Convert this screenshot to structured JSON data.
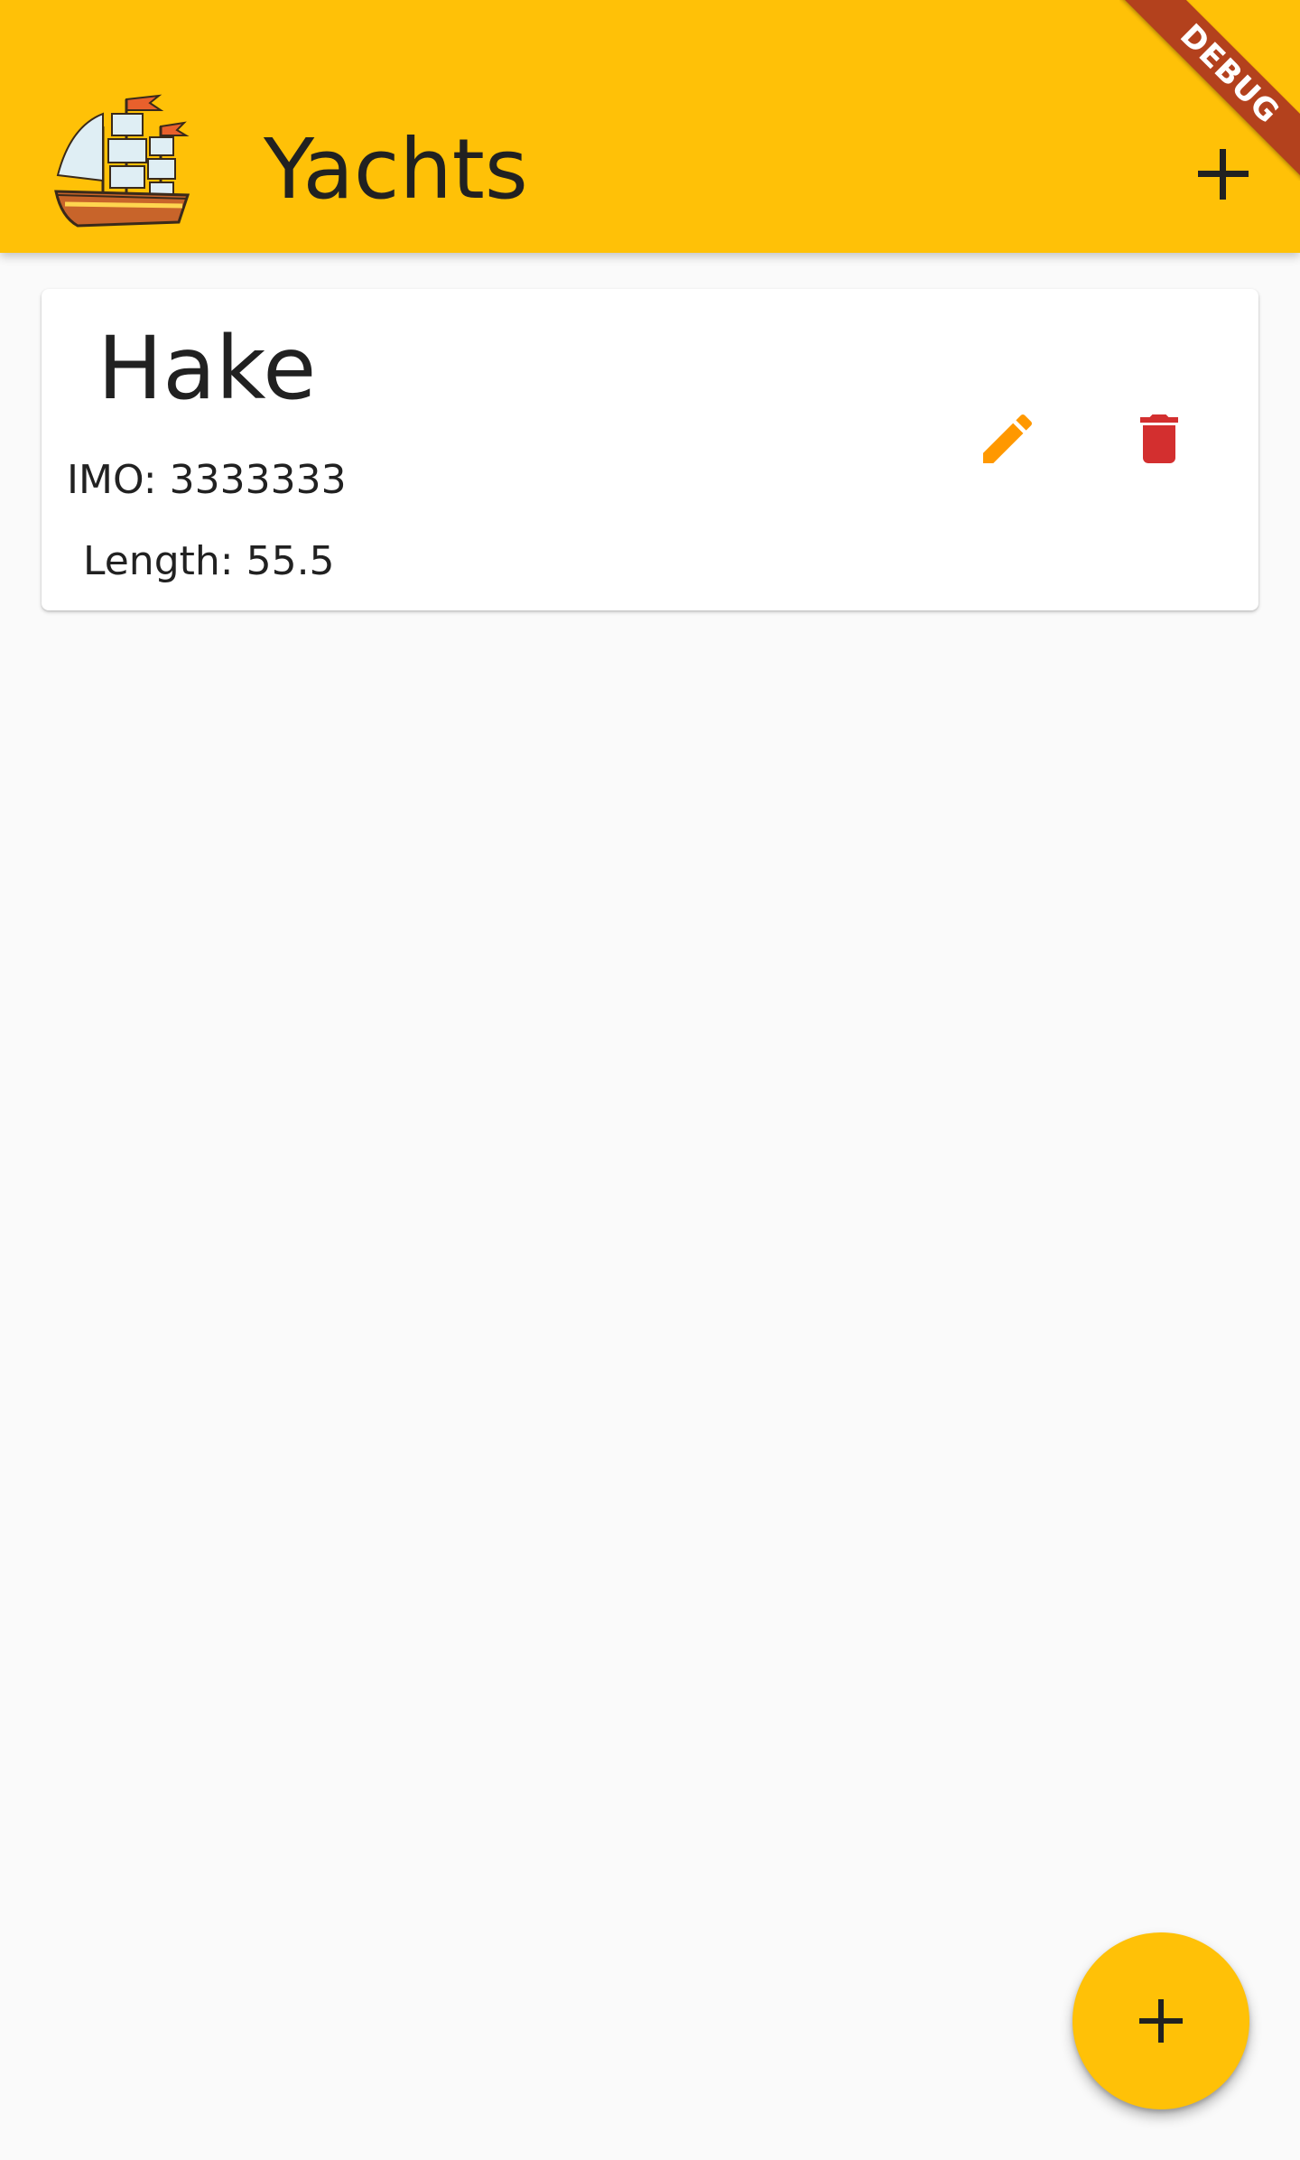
{
  "appbar": {
    "title": "Yachts",
    "logo_icon": "sailing-ship-icon",
    "add_icon": "plus-icon",
    "background_color": "#ffc107"
  },
  "debug_banner": {
    "label": "DEBUG",
    "color": "#b3411d"
  },
  "yachts": [
    {
      "name": "Hake",
      "imo_text": "IMO: 3333333",
      "length_text": "Length: 55.5",
      "edit_icon": "pencil-icon",
      "edit_icon_color": "#ff9800",
      "delete_icon": "trash-icon",
      "delete_icon_color": "#d32f2f"
    }
  ],
  "fab": {
    "icon": "plus-icon",
    "color": "#ffc107"
  }
}
